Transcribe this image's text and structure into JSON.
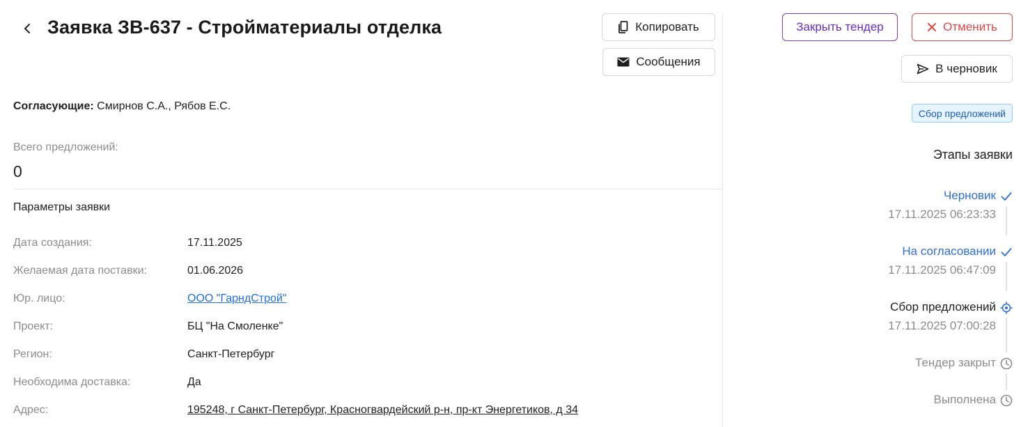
{
  "header": {
    "title": "Заявка ЗВ-637 - Стройматериалы отделка",
    "copy_label": "Копировать",
    "messages_label": "Сообщения"
  },
  "approvers": {
    "label": "Согласующие:",
    "value": "Смирнов С.А., Рябов Е.С."
  },
  "offers": {
    "label": "Всего предложений:",
    "value": "0"
  },
  "params": {
    "title": "Параметры заявки",
    "rows": [
      {
        "label": "Дата создания:",
        "value": "17.11.2025"
      },
      {
        "label": "Желаемая дата поставки:",
        "value": "01.06.2026"
      },
      {
        "label": "Юр. лицо:",
        "value": "ООО \"ГарндСтрой\""
      },
      {
        "label": "Проект:",
        "value": "БЦ \"На Смоленке\""
      },
      {
        "label": "Регион:",
        "value": "Санкт-Петербург"
      },
      {
        "label": "Необходима доставка:",
        "value": "Да"
      },
      {
        "label": "Адрес:",
        "value": "195248, г Санкт-Петербург, Красногвардейский р-н, пр-кт Энергетиков, д 34"
      }
    ]
  },
  "actions": {
    "close_tender_label": "Закрыть тендер",
    "cancel_label": "Отменить",
    "to_draft_label": "В черновик"
  },
  "status_badge": "Сбор предложений",
  "stages": {
    "title": "Этапы заявки",
    "items": [
      {
        "name": "Черновик",
        "date": "17.11.2025 06:23:33",
        "state": "done"
      },
      {
        "name": "На согласовании",
        "date": "17.11.2025 06:47:09",
        "state": "done"
      },
      {
        "name": "Сбор предложений",
        "date": "17.11.2025 07:00:28",
        "state": "current"
      },
      {
        "name": "Тендер закрыт",
        "date": "",
        "state": "pending"
      },
      {
        "name": "Выполнена",
        "date": "",
        "state": "pending"
      }
    ]
  },
  "colors": {
    "accent_blue": "#2f6fd9",
    "link_blue": "#1f6fe0",
    "close_purple": "#6a2cc4",
    "cancel_red": "#e04848",
    "muted_gray": "#8c8c8c"
  }
}
